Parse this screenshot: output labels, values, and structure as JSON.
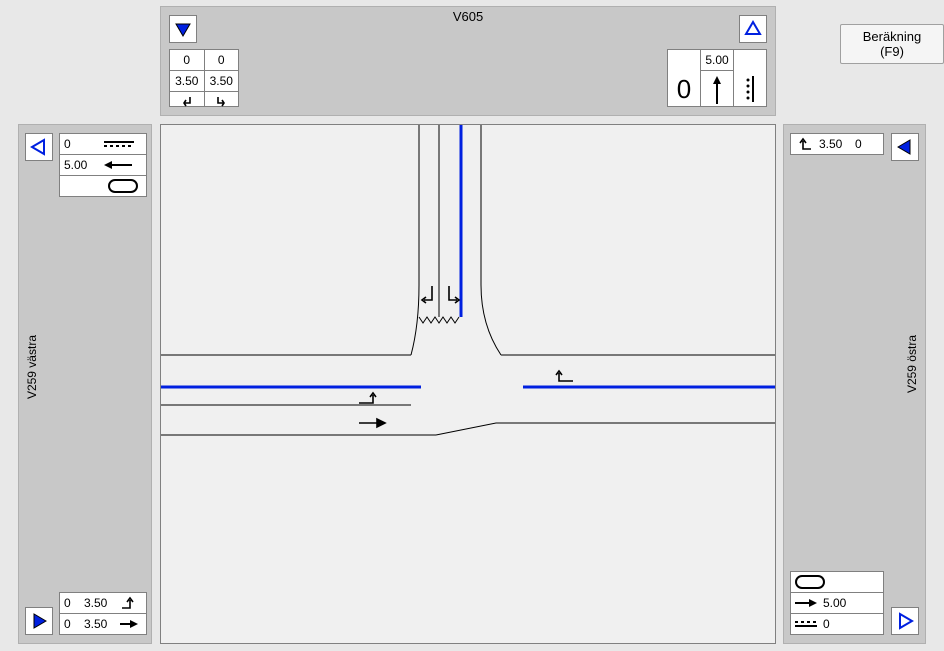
{
  "calc_button_label": "Beräkning (F9)",
  "approaches": {
    "north": {
      "title": "V605",
      "lanes_in": [
        {
          "extra": 0,
          "width": 3.5,
          "dir": "left-down"
        },
        {
          "extra": 0,
          "width": 3.5,
          "dir": "right-down"
        }
      ],
      "lanes_out": [
        {
          "label": "0",
          "dir": "island"
        },
        {
          "width": 5.0,
          "dir": "straight-up"
        },
        {
          "label": "⦙",
          "dir": "divider"
        }
      ]
    },
    "west": {
      "title": "V259 västra",
      "lanes_in_top": [
        {
          "width": 0.0,
          "style": "dashed"
        },
        {
          "width": 5.0,
          "style": "solid-arrow-left"
        },
        {
          "style": "island"
        }
      ],
      "lanes_in_bottom": [
        {
          "extra": 0,
          "width": 3.5,
          "dir": "up-right"
        },
        {
          "extra": 0,
          "width": 3.5,
          "dir": "straight-right"
        }
      ]
    },
    "east": {
      "title": "V259 östra",
      "lanes_in_top": [
        {
          "dir": "left-up",
          "width": 3.5,
          "extra": 0
        }
      ],
      "lanes_in_bottom": [
        {
          "style": "island"
        },
        {
          "style": "solid-arrow-right",
          "width": 5.0
        },
        {
          "style": "dashed",
          "width": 0.0
        }
      ]
    }
  },
  "diagram": {
    "description": "T-intersection: north arm (V605) joins east-west road (V259). North arm has two approach lanes (left-turn and right-turn, 3.50 m each) plus outbound 5.00 m lane. East-west road has one through lane each way (5.00 m) with 3.50 m approach lanes on west and east arms.",
    "signal_lines_color": "#0020e0"
  }
}
